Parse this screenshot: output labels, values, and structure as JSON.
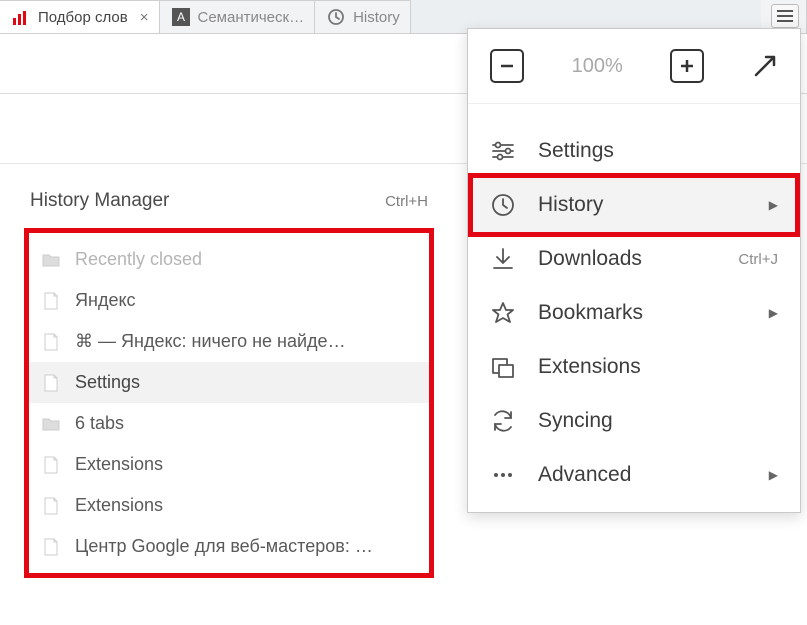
{
  "tabs": [
    {
      "label": "Подбор слов",
      "icon_color": "#e30613",
      "active": true,
      "closable": true
    },
    {
      "label": "Семантическ…",
      "icon_letter": "А",
      "icon_bg": "#555",
      "active": false
    },
    {
      "label": "History",
      "icon": "clock",
      "active": false
    }
  ],
  "history_panel": {
    "title": "History Manager",
    "shortcut": "Ctrl+H",
    "items": [
      {
        "label": "Recently closed",
        "icon": "folder",
        "faded": true
      },
      {
        "label": "Яндекс",
        "icon": "page"
      },
      {
        "label": "⌘ — Яндекс: ничего не найде…",
        "icon": "page"
      },
      {
        "label": "Settings",
        "icon": "page",
        "selected": true
      },
      {
        "label": "6 tabs",
        "icon": "folder"
      },
      {
        "label": "Extensions",
        "icon": "page"
      },
      {
        "label": "Extensions",
        "icon": "page"
      },
      {
        "label": "Центр Google для веб-мастеров: …",
        "icon": "page"
      }
    ]
  },
  "menu": {
    "zoom_level": "100%",
    "items": [
      {
        "label": "Settings",
        "icon": "sliders"
      },
      {
        "label": "History",
        "icon": "clock",
        "highlighted": true,
        "has_submenu": true
      },
      {
        "label": "Downloads",
        "icon": "download",
        "shortcut": "Ctrl+J"
      },
      {
        "label": "Bookmarks",
        "icon": "star",
        "has_submenu": true
      },
      {
        "label": "Extensions",
        "icon": "extensions"
      },
      {
        "label": "Syncing",
        "icon": "sync"
      },
      {
        "label": "Advanced",
        "icon": "dots",
        "has_submenu": true
      }
    ]
  }
}
